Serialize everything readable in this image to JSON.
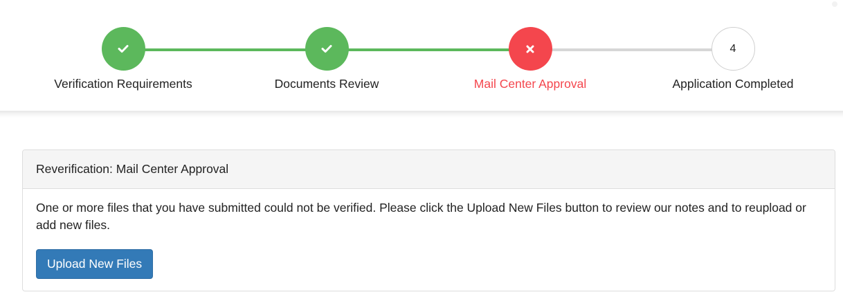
{
  "stepper": {
    "steps": [
      {
        "label": "Verification Requirements",
        "status": "complete",
        "icon": "check-icon"
      },
      {
        "label": "Documents Review",
        "status": "complete",
        "icon": "check-icon"
      },
      {
        "label": "Mail Center Approval",
        "status": "error",
        "icon": "x-icon"
      },
      {
        "label": "Application Completed",
        "status": "pending",
        "number": "4"
      }
    ],
    "colors": {
      "complete": "#5cb85c",
      "error": "#f4464d",
      "pending_line": "#d6d6d6"
    }
  },
  "panel": {
    "heading": "Reverification: Mail Center Approval",
    "message": "One or more files that you have submitted could not be verified. Please click the Upload New Files button to review our notes and to reupload or add new files.",
    "button_label": "Upload New Files",
    "button_color": "#337ab7"
  }
}
